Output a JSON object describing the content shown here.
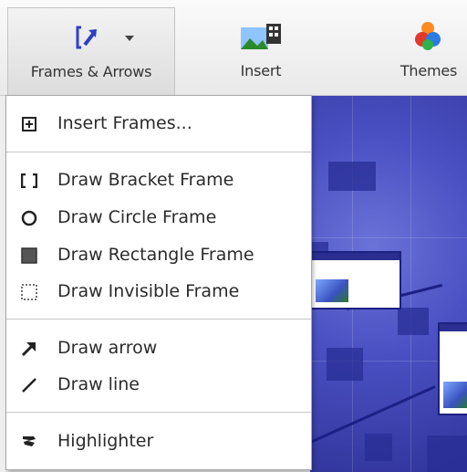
{
  "toolbar": {
    "frames_label": "Frames & Arrows",
    "insert_label": "Insert",
    "themes_label": "Themes"
  },
  "menu": {
    "insert_frames": "Insert Frames...",
    "bracket_frame": "Draw Bracket Frame",
    "circle_frame": "Draw Circle Frame",
    "rectangle_frame": "Draw Rectangle Frame",
    "invisible_frame": "Draw Invisible Frame",
    "arrow": "Draw arrow",
    "line": "Draw line",
    "highlighter": "Highlighter"
  },
  "icons": {
    "frames": "frames-arrows-icon",
    "insert": "insert-picture-icon",
    "themes": "themes-icon",
    "insert_frames": "plus-box-icon",
    "bracket": "bracket-icon",
    "circle": "circle-icon",
    "rectangle": "filled-square-icon",
    "invisible": "dotted-square-icon",
    "arrow": "arrow-icon",
    "line": "line-icon",
    "highlighter": "highlighter-icon"
  },
  "colors": {
    "accent_blue": "#2f3fc4",
    "canvas_blue": "#4a50c2",
    "menu_text": "#2b2b2b"
  }
}
